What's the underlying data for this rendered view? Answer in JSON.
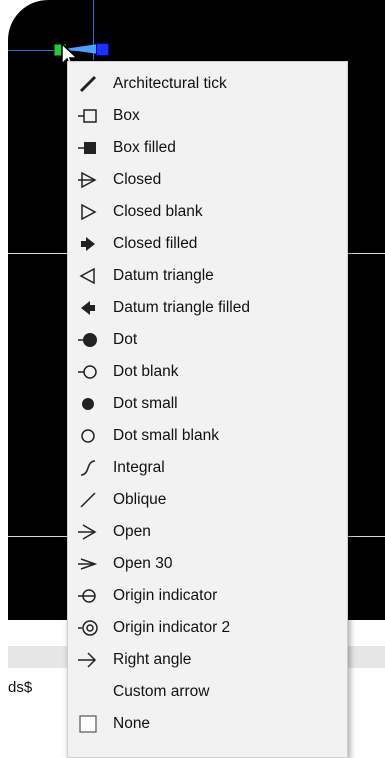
{
  "command_line": {
    "text": "ds$"
  },
  "menu": {
    "items": [
      {
        "label": "Architectural tick",
        "icon": "architectural-tick-icon"
      },
      {
        "label": "Box",
        "icon": "box-icon"
      },
      {
        "label": "Box filled",
        "icon": "box-filled-icon"
      },
      {
        "label": "Closed",
        "icon": "closed-arrow-icon"
      },
      {
        "label": "Closed blank",
        "icon": "closed-blank-arrow-icon"
      },
      {
        "label": "Closed filled",
        "icon": "closed-filled-arrow-icon"
      },
      {
        "label": "Datum triangle",
        "icon": "datum-triangle-icon"
      },
      {
        "label": "Datum triangle filled",
        "icon": "datum-triangle-filled-icon"
      },
      {
        "label": "Dot",
        "icon": "dot-icon"
      },
      {
        "label": "Dot blank",
        "icon": "dot-blank-icon"
      },
      {
        "label": "Dot small",
        "icon": "dot-small-icon"
      },
      {
        "label": "Dot small blank",
        "icon": "dot-small-blank-icon"
      },
      {
        "label": "Integral",
        "icon": "integral-icon"
      },
      {
        "label": "Oblique",
        "icon": "oblique-icon"
      },
      {
        "label": "Open",
        "icon": "open-arrow-icon"
      },
      {
        "label": "Open 30",
        "icon": "open-30-arrow-icon"
      },
      {
        "label": "Origin indicator",
        "icon": "origin-indicator-icon"
      },
      {
        "label": "Origin indicator 2",
        "icon": "origin-indicator-2-icon"
      },
      {
        "label": "Right angle",
        "icon": "right-angle-arrow-icon"
      },
      {
        "label": "Custom arrow",
        "icon": ""
      },
      {
        "label": "None",
        "icon": "none-checkbox-icon"
      }
    ]
  },
  "colors": {
    "canvas_bg": "#000000",
    "menu_bg": "#f2f2f2",
    "grip_green": "#27c93f",
    "grip_blue": "#1a33ff",
    "arrow_blue": "#4aa3ff"
  }
}
